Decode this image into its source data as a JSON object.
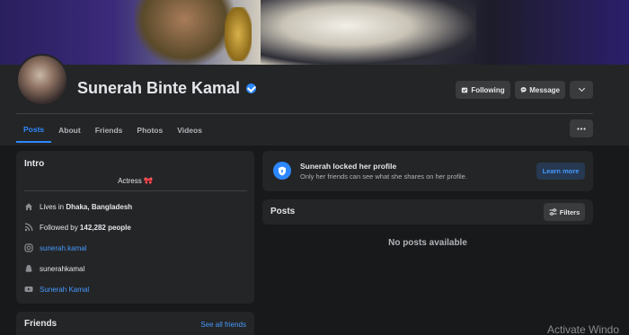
{
  "profile": {
    "name": "Sunerah Binte Kamal",
    "bio": "Actress 🎀"
  },
  "actions": {
    "following": "Following",
    "message": "Message"
  },
  "tabs": [
    "Posts",
    "About",
    "Friends",
    "Photos",
    "Videos"
  ],
  "intro": {
    "title": "Intro",
    "lives_prefix": "Lives in ",
    "lives_city": "Dhaka, Bangladesh",
    "followed_prefix": "Followed by ",
    "followed_count": "142,282 people",
    "instagram": "sunerah.kamal",
    "snapchat": "sunerahkamal",
    "youtube": "Sunerah Kamal"
  },
  "friends": {
    "title": "Friends",
    "see_all": "See all friends"
  },
  "locked": {
    "title": "Sunerah locked her profile",
    "subtitle": "Only her friends can see what she shares on her profile.",
    "learn_more": "Learn more"
  },
  "posts": {
    "title": "Posts",
    "filters": "Filters",
    "empty": "No posts available"
  },
  "watermark": "Activate Windo",
  "colors": {
    "accent": "#2d88ff",
    "background": "#18191a",
    "card": "#242526"
  },
  "icons": [
    "verified-badge-icon",
    "following-icon",
    "messenger-icon",
    "chevron-down-icon",
    "more-icon",
    "home-icon",
    "rss-icon",
    "instagram-icon",
    "snapchat-icon",
    "youtube-icon",
    "shield-icon",
    "filters-icon"
  ]
}
